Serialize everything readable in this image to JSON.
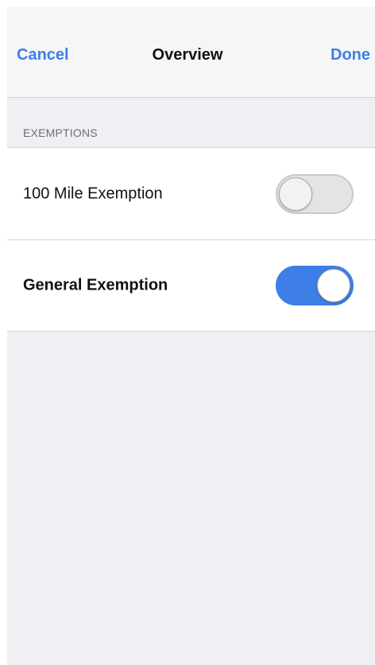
{
  "navbar": {
    "cancel_label": "Cancel",
    "title": "Overview",
    "done_label": "Done"
  },
  "section": {
    "header": "EXEMPTIONS",
    "rows": [
      {
        "label": "100 Mile Exemption",
        "enabled": false
      },
      {
        "label": "General Exemption",
        "enabled": true
      }
    ]
  },
  "colors": {
    "accent": "#3d7fe6",
    "background": "#efeff4",
    "navbar": "#f6f6f6"
  }
}
